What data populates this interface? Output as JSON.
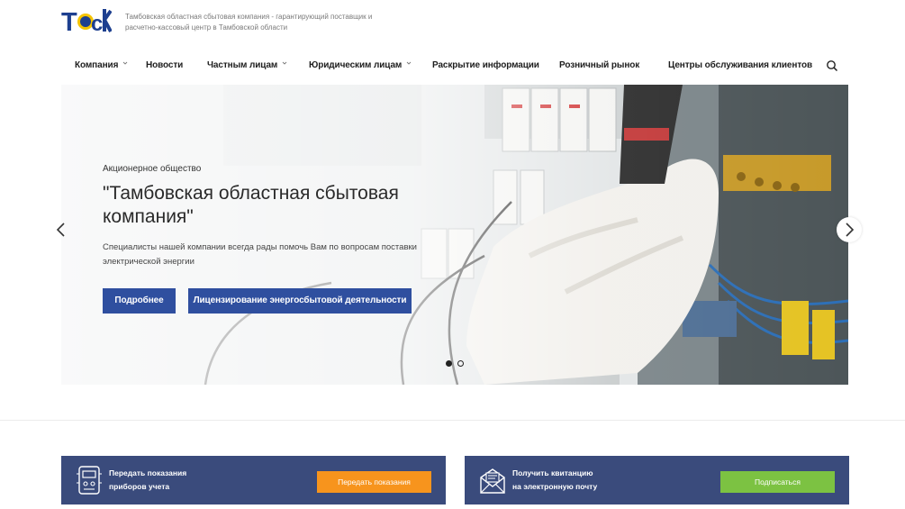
{
  "header": {
    "tagline": "Тамбовская областная сбытовая компания - гарантирующий поставщик и расчетно-кассовый центр в Тамбовской области",
    "logo_text": "ТОСК"
  },
  "nav": {
    "items": [
      {
        "label": "Компания",
        "dropdown": true
      },
      {
        "label": "Новости",
        "dropdown": false
      },
      {
        "label": "Частным лицам",
        "dropdown": true
      },
      {
        "label": "Юридическим лицам",
        "dropdown": true
      },
      {
        "label": "Раскрытие информации",
        "dropdown": false
      },
      {
        "label": "Розничный рынок",
        "dropdown": false
      },
      {
        "label": "Центры обслуживания клиентов",
        "dropdown": false
      }
    ],
    "search_icon": "search-icon"
  },
  "hero": {
    "kicker": "Акционерное общество",
    "title": "\"Тамбовская областная сбытовая компания\"",
    "description": "Специалисты нашей компании всегда рады помочь Вам по вопросам поставки электрической энергии",
    "btn_more": "Подробнее",
    "btn_license": "Лицензирование энергосбытовой деятельности",
    "slides_total": 2,
    "slide_active": 1
  },
  "cards": {
    "meters": {
      "label_line1": "Передать показания",
      "label_line2": "приборов учета",
      "button": "Передать показания",
      "icon": "meter-icon"
    },
    "receipt": {
      "label_line1": "Получить квитанцию",
      "label_line2": "на электронную почту",
      "button": "Подписаться",
      "icon": "envelope-icon"
    }
  },
  "colors": {
    "primary_button": "#2f4f9f",
    "card_bg": "#3a4b7c",
    "orange": "#f7941d",
    "green": "#7cc242",
    "logo_blue": "#1d3f8f",
    "logo_yellow": "#f5c400"
  }
}
